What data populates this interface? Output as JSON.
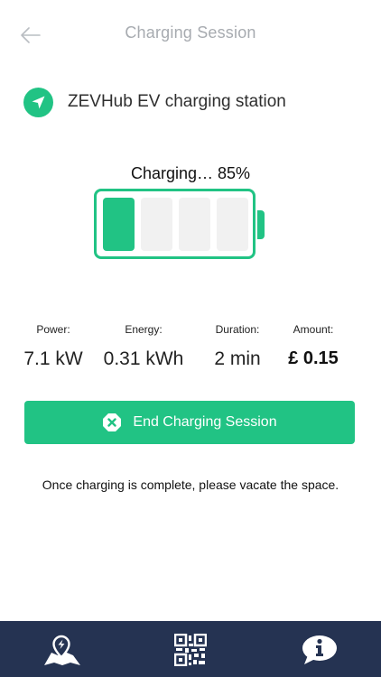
{
  "header": {
    "title": "Charging Session",
    "back_icon": "arrow-left-icon"
  },
  "station": {
    "name": "ZEVHub EV charging station",
    "icon": "navigation-arrow-icon"
  },
  "charging": {
    "status_text": "Charging… 85%",
    "percent": 85,
    "cells_total": 4,
    "cells_filled": 1
  },
  "stats": {
    "power": {
      "label": "Power:",
      "value": "7.1 kW"
    },
    "energy": {
      "label": "Energy:",
      "value": "0.31 kWh"
    },
    "duration": {
      "label": "Duration:",
      "value": "2 min"
    },
    "amount": {
      "label": "Amount:",
      "value": "£ 0.15"
    }
  },
  "end_button": {
    "label": "End Charging Session",
    "icon": "close-octagon-icon"
  },
  "notice": "Once charging is complete, please vacate the space.",
  "bottom_nav": {
    "items": [
      {
        "icon": "map-charging-icon"
      },
      {
        "icon": "qr-code-icon"
      },
      {
        "icon": "info-chat-icon"
      }
    ]
  },
  "colors": {
    "accent": "#21c384",
    "nav_background": "#253352",
    "header_text": "#a7abb0"
  }
}
